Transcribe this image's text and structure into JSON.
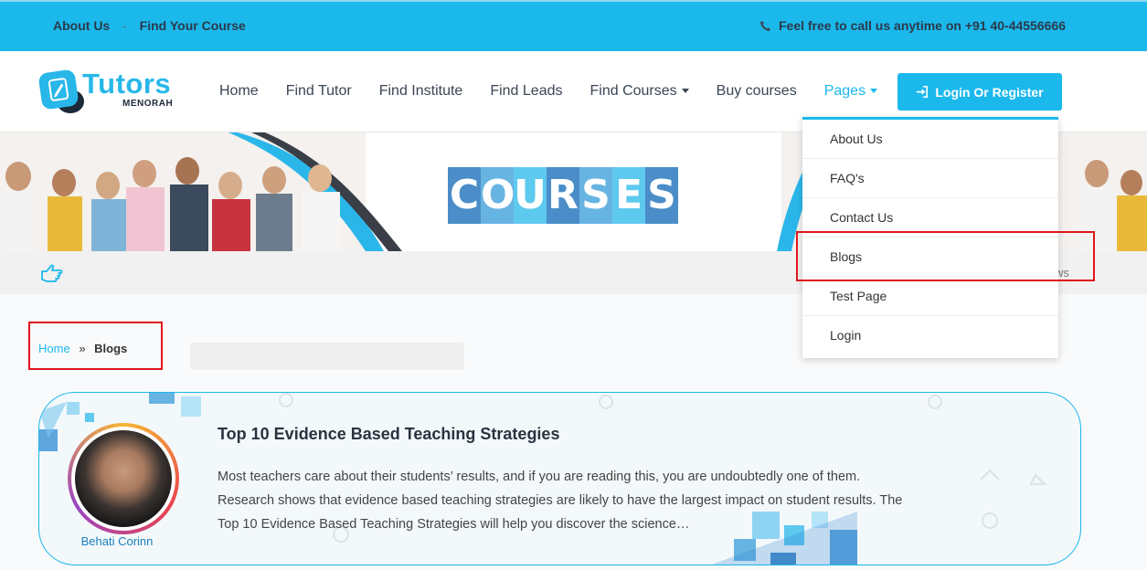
{
  "topbar": {
    "about": "About Us",
    "separator": "-",
    "find_course": "Find Your Course",
    "phone_text": "Feel free to call us anytime on +91 40-44556666"
  },
  "logo": {
    "word": "Tutors",
    "sub": "MENORAH"
  },
  "nav": {
    "items": [
      {
        "label": "Home"
      },
      {
        "label": "Find Tutor"
      },
      {
        "label": "Find Institute"
      },
      {
        "label": "Find Leads"
      },
      {
        "label": "Find Courses"
      },
      {
        "label": "Buy courses"
      },
      {
        "label": "Pages"
      }
    ],
    "login_label": "Login Or Register",
    "active_color": "#1bb8ec"
  },
  "banner": {
    "letters": [
      "C",
      "O",
      "U",
      "R",
      "S",
      "E",
      "S"
    ],
    "letter_colors": [
      "#4a8dc8",
      "#67b4e2",
      "#5ec9ef",
      "#4a8dc8",
      "#67b4e2",
      "#5ec9ef",
      "#4a8dc8"
    ]
  },
  "strip": {
    "tail_text": "ws"
  },
  "breadcrumb": {
    "home": "Home",
    "separator": "»",
    "current": "Blogs"
  },
  "post": {
    "title": "Top 10 Evidence Based Teaching Strategies",
    "excerpt": "Most teachers care about their students’ results, and if you are reading this, you are undoubtedly one of them. Research shows that evidence based teaching strategies are likely to have the largest impact on student results. The Top 10 Evidence Based Teaching Strategies will help you discover the science…",
    "author": "Behati Corinn"
  },
  "dropdown": {
    "options": [
      {
        "label": "About Us"
      },
      {
        "label": "FAQ's"
      },
      {
        "label": "Contact Us"
      },
      {
        "label": "Blogs"
      },
      {
        "label": "Test Page"
      },
      {
        "label": "Login"
      }
    ]
  },
  "colors": {
    "accent": "#1bb8ec",
    "highlight_box": "#e0151c"
  }
}
